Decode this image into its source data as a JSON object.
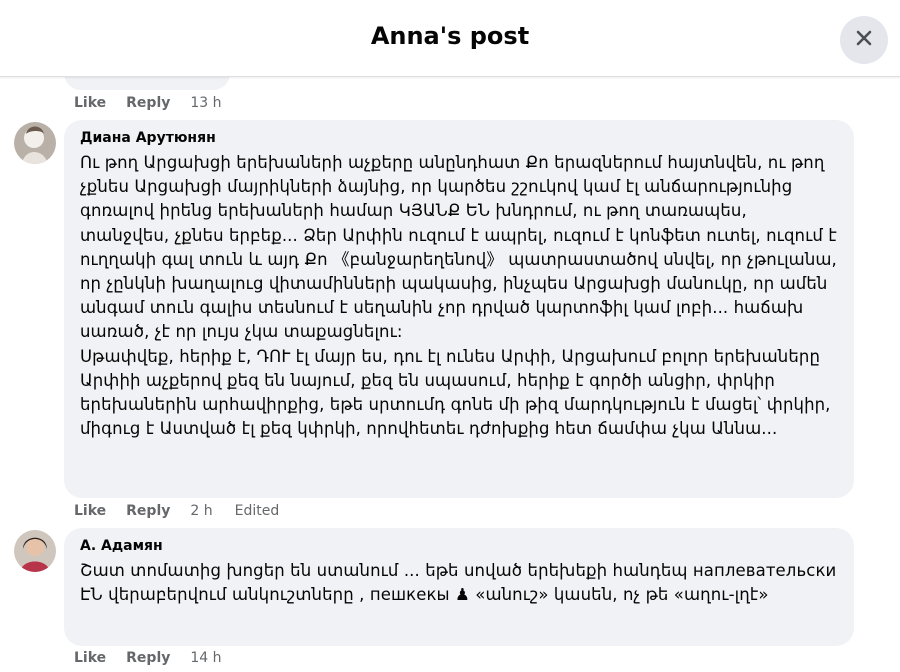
{
  "header": {
    "title": "Anna's post",
    "close_icon": "close-icon"
  },
  "colors": {
    "bubble_bg": "#f0f2f5",
    "meta_text": "#65676b",
    "close_button_bg": "#e4e6eb"
  },
  "comments": [
    {
      "partial": true,
      "actions": {
        "like": "Like",
        "reply": "Reply",
        "time": "13 h"
      }
    },
    {
      "author": "Диана Арутюнян",
      "avatar_icon": "avatar-photo",
      "text": "Ու թող Արցախցի երեխաների աչքերը անընդհատ Քո երազներում հայտնվեն, ու թող չքնես Արցախցի մայրիկների ձայնից, որ կարծես շշուկով կամ էլ անճարությունից գոռալով իրենց երեխաների համար ԿՅԱՆՔ ԵՆ խնդրում, ու թող տառապես, տանջվես, չքնես երբեք... Ձեր Արփին ուզում է ապրել, ուզում է կոնֆետ ուտել, ուզում է ուղղակի գալ տուն և այդ Քո 《բանջարեղենով》 պատրաստածով սնվել, որ չթուլանա, որ չընկնի խաղալուց վիտամինների պակասից, ինչպես Արցախցի մանուկը, որ ամեն անգամ տուն գալիս տեսնում է սեղանին չոր դրված կարտոֆիլ կամ լոբի... հաճախ սառած, չէ որ լույս չկա տաքացնելու:\nՍթափվեք, հերիք է, ԴՈՒ էլ մայր ես, դու էլ ունես Արփի, Արցախում բոլոր երեխաները Արփիի աչքերով քեզ են նայում, քեզ են սպասում, հերիք է գործի անցիր, փրկիր երեխաներին արհավիրքից, եթե սրտումդ գոնե մի թիզ մարդկություն է մացել՝ փրկիր, միգուց է Աստված էլ քեզ կփրկի, որովհետեւ դժոխքից հետ ճամփա չկա Աննա...",
      "actions": {
        "like": "Like",
        "reply": "Reply",
        "time": "2 h",
        "edited": "Edited"
      }
    },
    {
      "author": "А. Адамян",
      "avatar_icon": "avatar-photo",
      "text": "Շատ տոմատից խոցեր են ստանում ... եթե սոված երեխեքի հանդեպ наплевательски ԷՆ վերաբերվում անկուշտները , пешкекы ♟ «անուշ» կասեն, ոչ թե «աղու-լղէ»",
      "actions": {
        "like": "Like",
        "reply": "Reply",
        "time": "14 h"
      }
    }
  ]
}
